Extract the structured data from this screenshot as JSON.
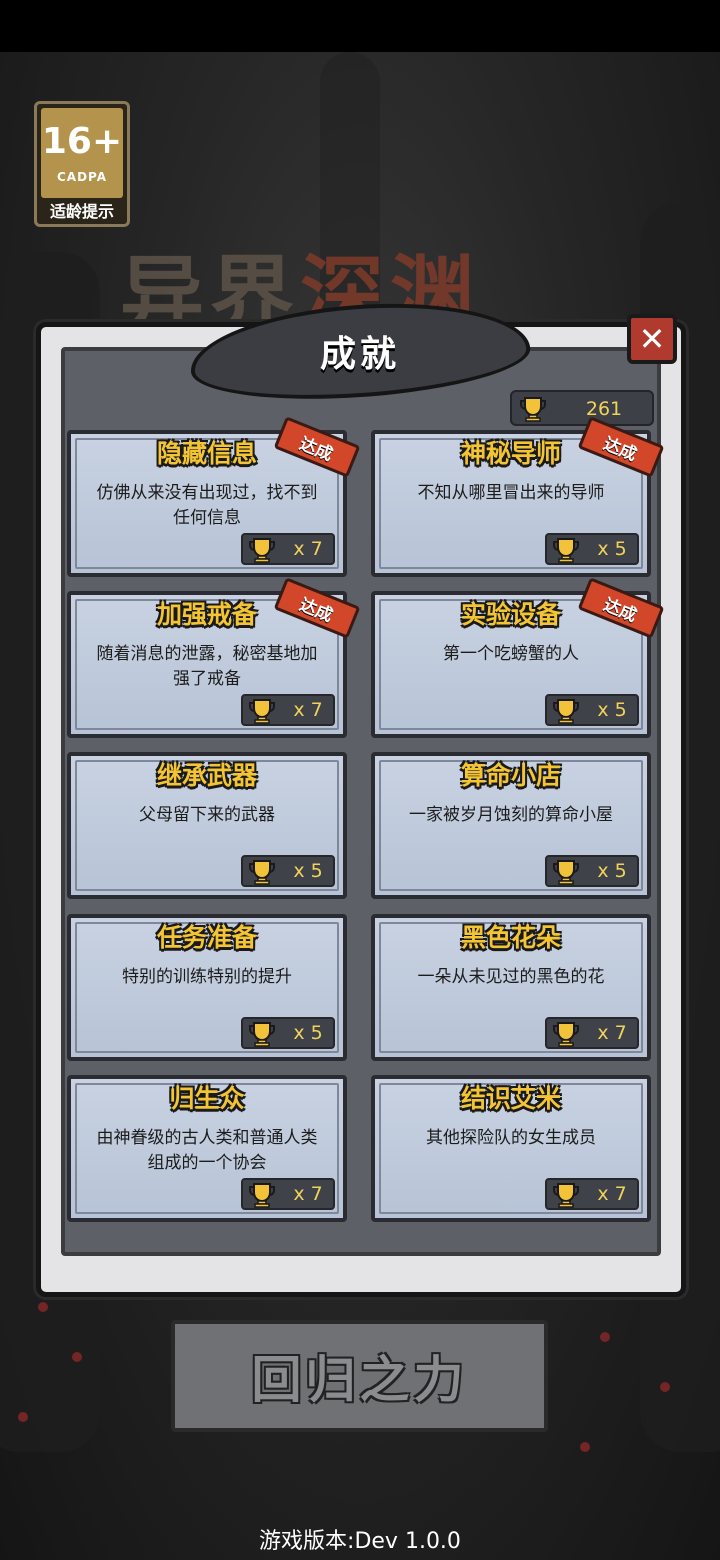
{
  "age_rating": {
    "age": "16+",
    "org": "CADPA",
    "tip": "适龄提示"
  },
  "game_title": {
    "part1": "异界",
    "part2": "深渊"
  },
  "panel": {
    "title": "成就",
    "close_symbol": "✕"
  },
  "currency": {
    "icon": "trophy-cup-icon",
    "value": "261"
  },
  "achievements": [
    {
      "title": "隐藏信息",
      "desc": "仿佛从来没有出现过，找不到任何信息",
      "reward": "x 7",
      "done": "达成"
    },
    {
      "title": "神秘导师",
      "desc": "不知从哪里冒出来的导师",
      "reward": "x 5",
      "done": "达成"
    },
    {
      "title": "加强戒备",
      "desc": "随着消息的泄露，秘密基地加强了戒备",
      "reward": "x 7",
      "done": "达成"
    },
    {
      "title": "实验设备",
      "desc": "第一个吃螃蟹的人",
      "reward": "x 5",
      "done": "达成"
    },
    {
      "title": "继承武器",
      "desc": "父母留下来的武器",
      "reward": "x 5",
      "done": ""
    },
    {
      "title": "算命小店",
      "desc": "一家被岁月蚀刻的算命小屋",
      "reward": "x 5",
      "done": ""
    },
    {
      "title": "任务准备",
      "desc": "特别的训练特别的提升",
      "reward": "x 5",
      "done": ""
    },
    {
      "title": "黑色花朵",
      "desc": "一朵从未见过的黑色的花",
      "reward": "x 7",
      "done": ""
    },
    {
      "title": "归生众",
      "desc": "由神眷级的古人类和普通人类组成的一个协会",
      "reward": "x 7",
      "done": ""
    },
    {
      "title": "结识艾米",
      "desc": "其他探险队的女生成员",
      "reward": "x 7",
      "done": ""
    }
  ],
  "recall_button": {
    "label": "回归之力"
  },
  "version": "游戏版本:Dev 1.0.0",
  "colors": {
    "accent_gold": "#f3c433",
    "done_red": "#d2462a",
    "card_bg": "#c8d2e2",
    "panel_bg": "#e4e4e6"
  }
}
